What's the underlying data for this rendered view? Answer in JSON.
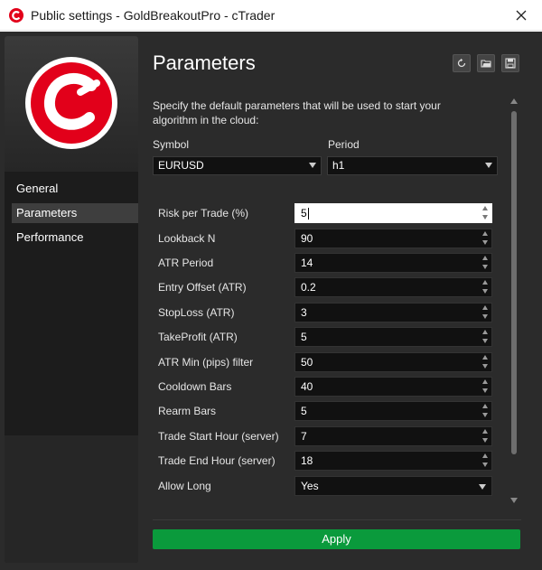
{
  "window": {
    "title": "Public settings - GoldBreakoutPro - cTrader"
  },
  "sidebar": {
    "items": [
      {
        "label": "General",
        "active": false
      },
      {
        "label": "Parameters",
        "active": true
      },
      {
        "label": "Performance",
        "active": false
      }
    ]
  },
  "main": {
    "heading": "Parameters",
    "description": "Specify the default parameters that will be used to start your algorithm in the cloud:",
    "symbol_label": "Symbol",
    "symbol_value": "EURUSD",
    "period_label": "Period",
    "period_value": "h1",
    "params": [
      {
        "label": "Risk per Trade (%)",
        "value": "5",
        "type": "number",
        "focused": true
      },
      {
        "label": "Lookback N",
        "value": "90",
        "type": "number"
      },
      {
        "label": "ATR Period",
        "value": "14",
        "type": "number"
      },
      {
        "label": "Entry Offset (ATR)",
        "value": "0.2",
        "type": "number"
      },
      {
        "label": "StopLoss (ATR)",
        "value": "3",
        "type": "number"
      },
      {
        "label": "TakeProfit (ATR)",
        "value": "5",
        "type": "number"
      },
      {
        "label": "ATR Min (pips) filter",
        "value": "50",
        "type": "number"
      },
      {
        "label": "Cooldown Bars",
        "value": "40",
        "type": "number"
      },
      {
        "label": "Rearm Bars",
        "value": "5",
        "type": "number"
      },
      {
        "label": "Trade Start Hour (server)",
        "value": "7",
        "type": "number"
      },
      {
        "label": "Trade End Hour (server)",
        "value": "18",
        "type": "number"
      },
      {
        "label": "Allow Long",
        "value": "Yes",
        "type": "select"
      }
    ],
    "apply_label": "Apply"
  },
  "colors": {
    "accent": "#e2001a",
    "apply": "#0a9a3c",
    "background": "#2b2b2b"
  },
  "icons": [
    "close-icon",
    "reset-icon",
    "open-folder-icon",
    "save-icon",
    "chevron-down-icon",
    "spinner-icon"
  ]
}
